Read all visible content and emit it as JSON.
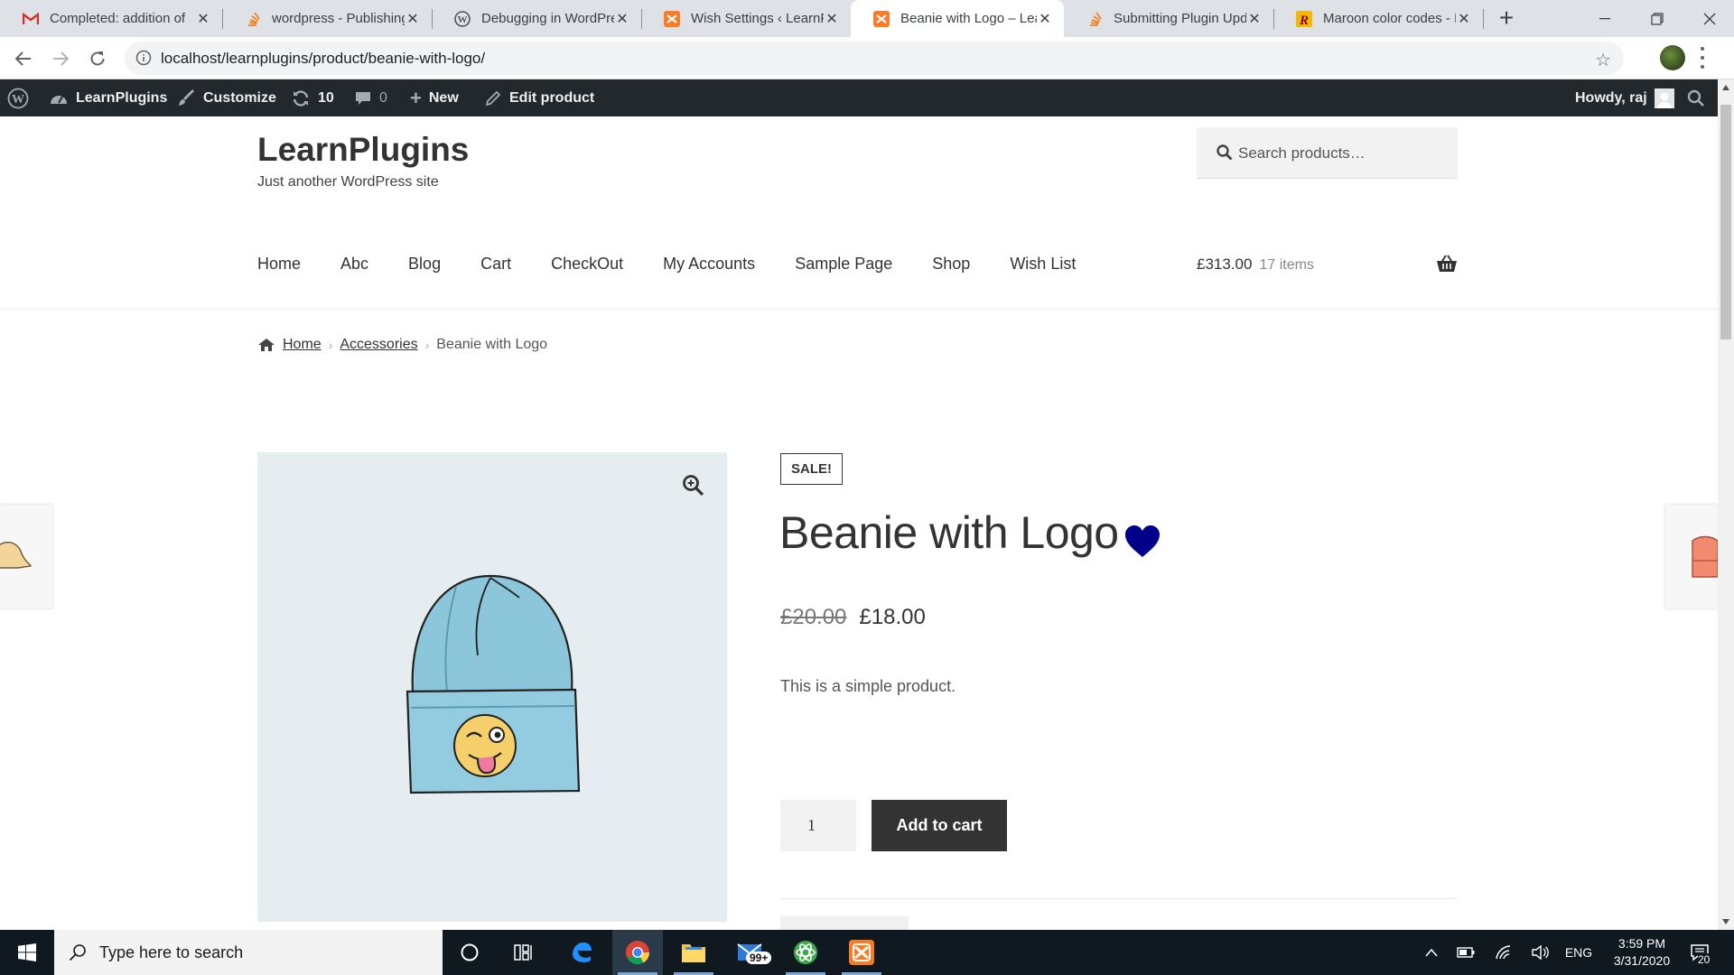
{
  "browser": {
    "tabs": [
      {
        "title": "Completed: addition of",
        "favicon": "gmail-icon"
      },
      {
        "title": "wordpress - Publishing",
        "favicon": "stackoverflow-icon"
      },
      {
        "title": "Debugging in WordPre",
        "favicon": "wordpress-icon"
      },
      {
        "title": "Wish Settings ‹ LearnPl",
        "favicon": "xampp-icon"
      },
      {
        "title": "Beanie with Logo – Lea",
        "favicon": "xampp-icon",
        "active": true
      },
      {
        "title": "Submitting Plugin Upd",
        "favicon": "stackoverflow-icon"
      },
      {
        "title": "Maroon color codes - F",
        "favicon": "r-icon"
      }
    ],
    "url": "localhost/learnplugins/product/beanie-with-logo/"
  },
  "adminbar": {
    "site_name": "LearnPlugins",
    "customize": "Customize",
    "updates": "10",
    "comments": "0",
    "new": "New",
    "edit": "Edit product",
    "howdy": "Howdy, raj"
  },
  "site": {
    "title": "LearnPlugins",
    "description": "Just another WordPress site",
    "search_placeholder": "Search products…"
  },
  "menu": [
    "Home",
    "Abc",
    "Blog",
    "Cart",
    "CheckOut",
    "My Accounts",
    "Sample Page",
    "Shop",
    "Wish List"
  ],
  "cart": {
    "total": "£313.00",
    "count": "17 items"
  },
  "breadcrumb": {
    "home": "Home",
    "category": "Accessories",
    "current": "Beanie with Logo"
  },
  "product": {
    "badge": "SALE!",
    "title": "Beanie with Logo",
    "old_price": "£20.00",
    "price": "£18.00",
    "short_description": "This is a simple product.",
    "quantity": "1",
    "add_to_cart": "Add to cart",
    "wishlist_color": "#00008b"
  },
  "taskbar": {
    "search_placeholder": "Type here to search",
    "mail_badge": "99+",
    "language": "ENG",
    "time": "3:59 PM",
    "date": "3/31/2020",
    "notifications": "20"
  }
}
